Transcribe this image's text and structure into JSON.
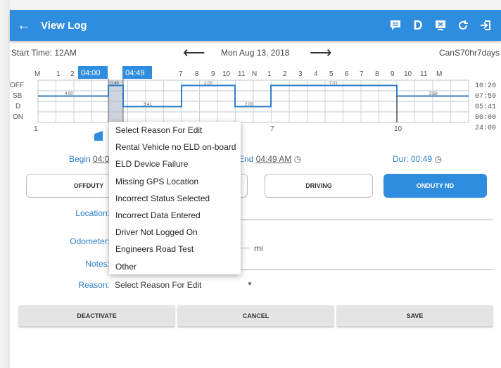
{
  "appbar": {
    "title": "View Log",
    "back_icon": "arrow-back-icon",
    "actions": [
      {
        "name": "notes-icon",
        "glyph": "▤"
      },
      {
        "name": "d-icon",
        "glyph": "D"
      },
      {
        "name": "inspect-icon",
        "glyph": "⊠"
      },
      {
        "name": "refresh-icon",
        "glyph": "↻"
      },
      {
        "name": "logout-icon",
        "glyph": "⇥"
      }
    ],
    "color": "#2f8de0"
  },
  "nav": {
    "start_time": "Start Time: 12AM",
    "date": "Mon Aug 13, 2018",
    "cycle": "CanS70hr7days"
  },
  "graph": {
    "hour_labels": [
      "M",
      "1",
      "2",
      "3",
      "4",
      "5",
      "6",
      "7",
      "8",
      "9",
      "10",
      "11",
      "N",
      "1",
      "2",
      "3",
      "4",
      "5",
      "6",
      "7",
      "8",
      "9",
      "10",
      "11",
      "M"
    ],
    "row_labels": [
      "OFF",
      "SB",
      "D",
      "ON"
    ],
    "totals": [
      "10:20",
      "07:59",
      "05:41",
      "00:00",
      "24:00"
    ],
    "segment_labels": [
      "4:00",
      "0:49",
      "3:41",
      "2:00",
      "2:00",
      "7:01",
      "3:59"
    ],
    "selection_labels": [
      "04:00",
      "04:49"
    ],
    "day_labels": [
      "1",
      "2",
      "7",
      "10"
    ]
  },
  "times": {
    "begin_label": "Begin",
    "begin_value": "04:0",
    "end_label": "End",
    "end_value": "04:49 AM",
    "dur": "Dur: 00:49"
  },
  "statuses": [
    {
      "label": "OFFDUTY"
    },
    {
      "label": "DRIVING"
    },
    {
      "label": "ONDUTY ND"
    }
  ],
  "form": {
    "location_label": "Location:",
    "odometer_label": "Odometer:",
    "odometer_unit": "mi",
    "notes_label": "Notes:",
    "reason_label": "Reason:",
    "reason_value": "Select Reason For Edit"
  },
  "dropdown": {
    "options": [
      "Select Reason For Edit",
      "Rental Vehicle no ELD on-board",
      "ELD Device Failure",
      "Missing GPS Location",
      "Incorrect Status Selected",
      "Incorrect Data Entered",
      "Driver Not Logged On",
      "Engineers Road Test",
      "Other"
    ]
  },
  "buttons": {
    "deactivate": "DEACTIVATE",
    "cancel": "CANCEL",
    "save": "SAVE"
  }
}
